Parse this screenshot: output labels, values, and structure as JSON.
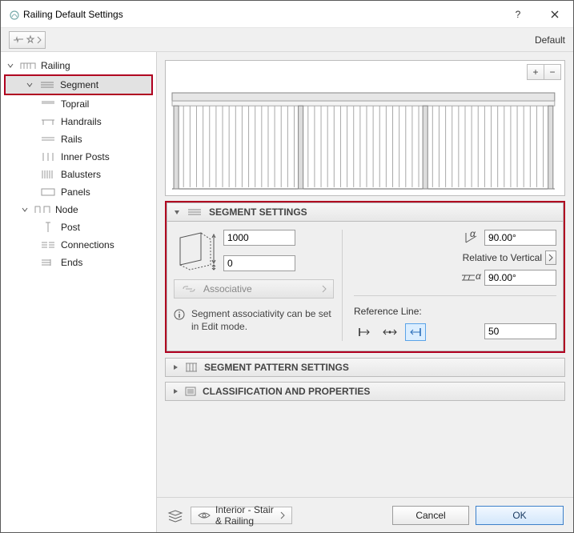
{
  "window": {
    "title": "Railing Default Settings"
  },
  "toolbar": {
    "mode_label": "Default"
  },
  "tree": {
    "railing": "Railing",
    "segment": "Segment",
    "toprail": "Toprail",
    "handrails": "Handrails",
    "rails": "Rails",
    "inner_posts": "Inner Posts",
    "balusters": "Balusters",
    "panels": "Panels",
    "node": "Node",
    "post": "Post",
    "connections": "Connections",
    "ends": "Ends"
  },
  "segment_settings": {
    "header": "SEGMENT SETTINGS",
    "height_value": "1000",
    "offset_value": "0",
    "angle_top": "90.00°",
    "relative_label": "Relative to Vertical",
    "angle_bottom": "90.00°",
    "associative_label": "Associative",
    "info_text": "Segment associativity can be set in Edit mode.",
    "reference_line_label": "Reference Line:",
    "reference_offset": "50"
  },
  "panels_collapsed": {
    "pattern": "SEGMENT PATTERN SETTINGS",
    "classification": "CLASSIFICATION AND PROPERTIES"
  },
  "footer": {
    "layer": "Interior - Stair & Railing",
    "cancel": "Cancel",
    "ok": "OK"
  },
  "icons": {
    "plus": "+",
    "minus": "−"
  }
}
